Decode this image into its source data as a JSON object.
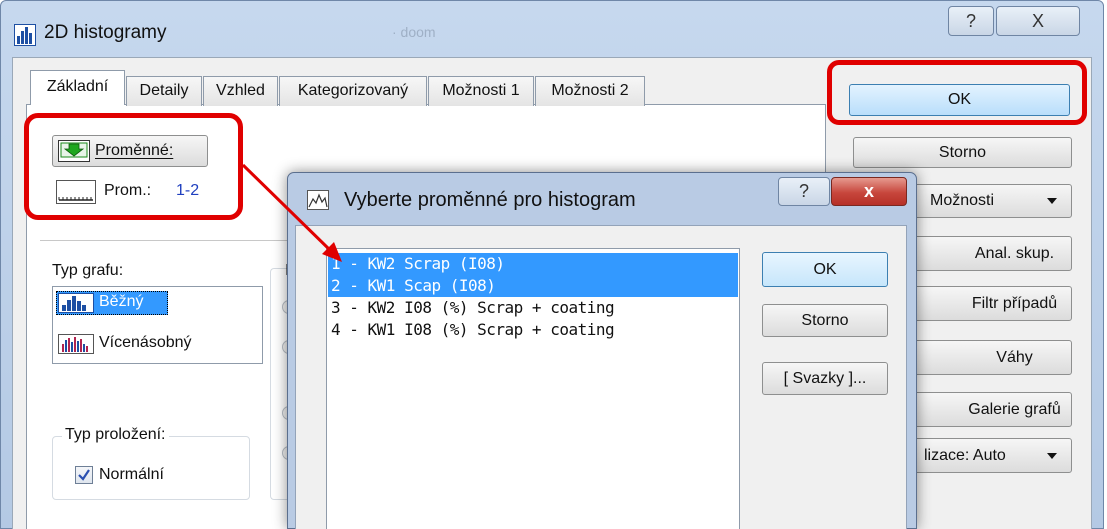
{
  "main": {
    "title": "2D histogramy",
    "bg_title": "· doom",
    "help_glyph": "?",
    "close_glyph": "X",
    "tabs": [
      {
        "label": "Základní"
      },
      {
        "label": "Detaily"
      },
      {
        "label": "Vzhled"
      },
      {
        "label": "Kategorizovaný"
      },
      {
        "label": "Možnosti 1"
      },
      {
        "label": "Možnosti 2"
      }
    ],
    "variables_button": "Proměnné:",
    "prom_label": "Prom.:",
    "prom_value": "1-2",
    "graph_type": {
      "label": "Typ grafu:",
      "items": [
        {
          "label": "Běžný",
          "selected": true
        },
        {
          "label": "Vícenásobný",
          "selected": false
        }
      ]
    },
    "fit_type": {
      "label": "Typ proložení:",
      "checkbox_label": "Normální",
      "checked": true
    },
    "partial_label": "I",
    "buttons": {
      "ok": "OK",
      "storno": "Storno",
      "moznosti": "Možnosti",
      "anal_skup": "Anal. skup.",
      "filtr": "Filtr případů",
      "vahy": "Váhy",
      "galerie": "Galerie grafů",
      "lizace": "lizace: Auto"
    }
  },
  "dialog": {
    "title": "Vyberte proměnné pro histogram",
    "help_glyph": "?",
    "close_glyph": "x",
    "items": [
      {
        "label": "1 - KW2 Scrap (I08)",
        "selected": true
      },
      {
        "label": "2 - KW1 Scap (I08)",
        "selected": true
      },
      {
        "label": "3 - KW2 I08 (%) Scrap + coating",
        "selected": false
      },
      {
        "label": "4 - KW1 I08 (%) Scrap + coating",
        "selected": false
      }
    ],
    "ok": "OK",
    "storno": "Storno",
    "svazky": "[ Svazky ]..."
  },
  "colors": {
    "highlight": "#e00000",
    "selection": "#3399ff",
    "close_button": "#c7463c",
    "ok_button": "#cfeaff"
  }
}
